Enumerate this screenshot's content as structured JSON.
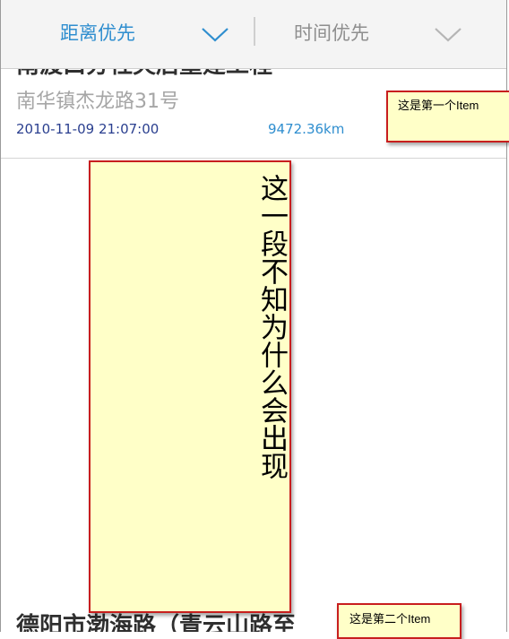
{
  "tabs": [
    {
      "label": "距离优先",
      "active": true,
      "color": "#2f8ecf"
    },
    {
      "label": "时间优先",
      "active": false,
      "color": "#8e8e8e"
    }
  ],
  "list": {
    "items": [
      {
        "title": "南渡口分社灾后重建工程",
        "address": "南华镇杰龙路31号",
        "time": "2010-11-09 21:07:00",
        "distance": "9472.36km"
      },
      {
        "title": "德阳市渤海路（青云山路至",
        "address": "",
        "time": "",
        "distance": ""
      }
    ]
  },
  "annotations": {
    "note1": "这是第一个Item",
    "note2": "这一段不知为什么会出现",
    "note3": "这是第二个Item"
  },
  "colors": {
    "accent": "#2f8ecf",
    "note_bg": "#ffffc8",
    "note_border": "#c81e1e"
  },
  "icons": [
    "chevron-down-icon",
    "chevron-down-icon"
  ]
}
